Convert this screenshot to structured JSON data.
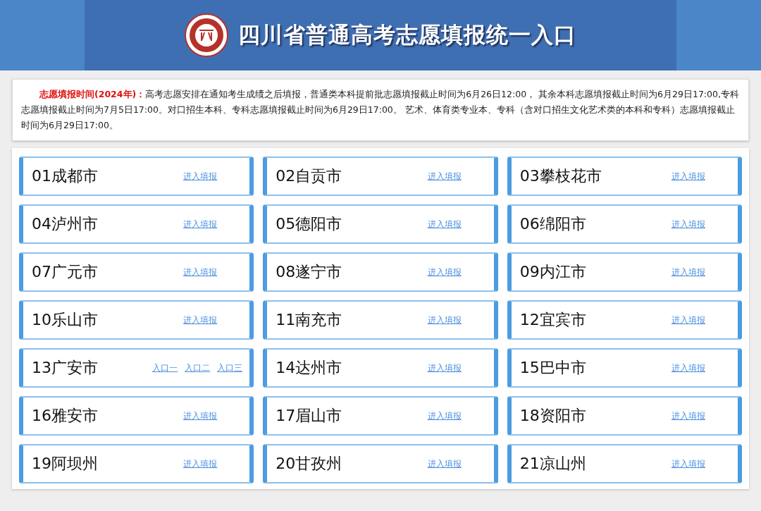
{
  "header": {
    "title": "四川省普通高考志愿填报统一入口"
  },
  "notice": {
    "label": "志愿填报时间(2024年)：",
    "text": "高考志愿安排在通知考生成绩之后填报，普通类本科提前批志愿填报截止时间为6月26日12:00， 其余本科志愿填报截止时间为6月29日17:00,专科志愿填报截止时间为7月5日17:00。对口招生本科、专科志愿填报截止时间为6月29日17:00。 艺术、体育类专业本、专科（含对口招生文化艺术类的本科和专科）志愿填报截止时间为6月29日17:00。"
  },
  "cities": [
    {
      "name": "01成都市",
      "links": [
        "进入填报"
      ]
    },
    {
      "name": "02自贡市",
      "links": [
        "进入填报"
      ]
    },
    {
      "name": "03攀枝花市",
      "links": [
        "进入填报"
      ]
    },
    {
      "name": "04泸州市",
      "links": [
        "进入填报"
      ]
    },
    {
      "name": "05德阳市",
      "links": [
        "进入填报"
      ]
    },
    {
      "name": "06绵阳市",
      "links": [
        "进入填报"
      ]
    },
    {
      "name": "07广元市",
      "links": [
        "进入填报"
      ]
    },
    {
      "name": "08遂宁市",
      "links": [
        "进入填报"
      ]
    },
    {
      "name": "09内江市",
      "links": [
        "进入填报"
      ]
    },
    {
      "name": "10乐山市",
      "links": [
        "进入填报"
      ]
    },
    {
      "name": "11南充市",
      "links": [
        "进入填报"
      ]
    },
    {
      "name": "12宜宾市",
      "links": [
        "进入填报"
      ]
    },
    {
      "name": "13广安市",
      "links": [
        "入口一",
        "入口二",
        "入口三"
      ]
    },
    {
      "name": "14达州市",
      "links": [
        "进入填报"
      ]
    },
    {
      "name": "15巴中市",
      "links": [
        "进入填报"
      ]
    },
    {
      "name": "16雅安市",
      "links": [
        "进入填报"
      ]
    },
    {
      "name": "17眉山市",
      "links": [
        "进入填报"
      ]
    },
    {
      "name": "18资阳市",
      "links": [
        "进入填报"
      ]
    },
    {
      "name": "19阿坝州",
      "links": [
        "进入填报"
      ]
    },
    {
      "name": "20甘孜州",
      "links": [
        "进入填报"
      ]
    },
    {
      "name": "21凉山州",
      "links": [
        "进入填报"
      ]
    }
  ]
}
